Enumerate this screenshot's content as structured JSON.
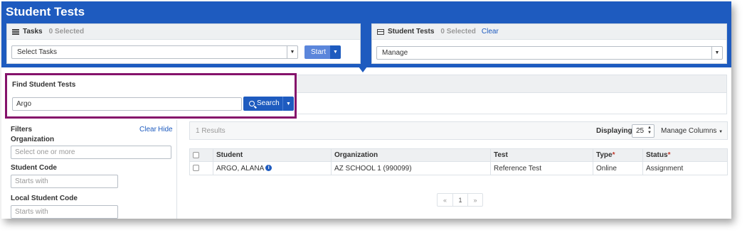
{
  "app": {
    "title": "Student Tests"
  },
  "tasks_panel": {
    "title": "Tasks",
    "selected": "0 Selected",
    "select_value": "Select Tasks",
    "start_label": "Start"
  },
  "student_tests_panel": {
    "title": "Student Tests",
    "selected": "0 Selected",
    "clear_label": "Clear",
    "select_value": "Manage"
  },
  "find": {
    "title": "Find Student Tests",
    "search_value": "Argo",
    "search_button": "Search"
  },
  "filters": {
    "title": "Filters",
    "clear_label": "Clear",
    "hide_label": "Hide",
    "organization_label": "Organization",
    "organization_placeholder": "Select one or more",
    "student_code_label": "Student Code",
    "student_code_placeholder": "Starts with",
    "local_student_code_label": "Local Student Code",
    "local_student_code_placeholder": "Starts with"
  },
  "results": {
    "count_text": "1 Results",
    "displaying_label": "Displaying",
    "page_size": "25",
    "manage_columns": "Manage Columns"
  },
  "table": {
    "headers": {
      "student": "Student",
      "organization": "Organization",
      "test": "Test",
      "type": "Type",
      "status": "Status",
      "required_mark": "*"
    },
    "rows": [
      {
        "student": "ARGO, ALANA",
        "organization": "AZ SCHOOL 1 (990099)",
        "test": "Reference Test",
        "type": "Online",
        "status": "Assignment"
      }
    ]
  },
  "pagination": {
    "prev": "«",
    "current": "1",
    "next": "»"
  },
  "colors": {
    "brand_blue": "#1e5bbf",
    "highlight_purple": "#85126b",
    "start_button": "#5b86db"
  }
}
